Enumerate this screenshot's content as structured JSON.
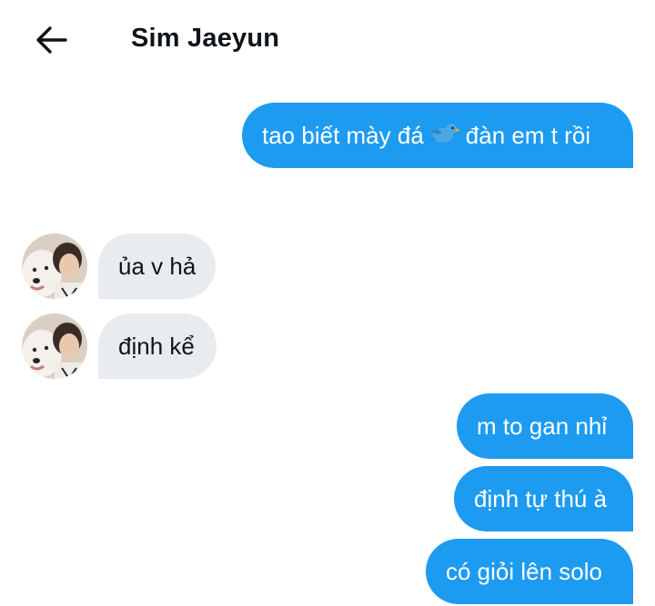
{
  "header": {
    "title": "Sim Jaeyun",
    "back_icon": "arrow-left-icon"
  },
  "messages": [
    {
      "direction": "out",
      "text_before": "tao biết mày đá",
      "emoji": "bird-icon",
      "text_after": "đàn em t rồi"
    },
    {
      "direction": "in",
      "text": "ủa v hả"
    },
    {
      "direction": "in",
      "text": "định kể"
    },
    {
      "direction": "out",
      "text": "m to gan nhỉ"
    },
    {
      "direction": "out",
      "text": "định tự thú à"
    },
    {
      "direction": "out",
      "text": "có giỏi lên solo"
    }
  ],
  "colors": {
    "outgoing_bubble": "#1d9bf0",
    "incoming_bubble": "#e8ecef",
    "bird_emoji": "#4aa8e6"
  }
}
